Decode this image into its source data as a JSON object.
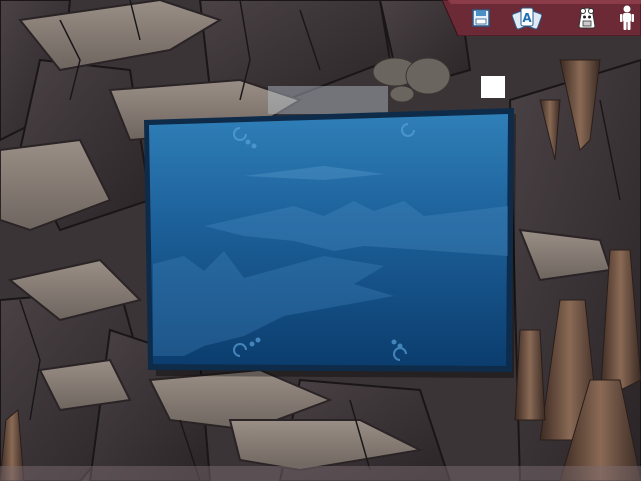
{
  "scene": {
    "type": "cave"
  },
  "toolbar": {
    "buttons": [
      {
        "id": "save",
        "icon": "save-disk-icon"
      },
      {
        "id": "cards",
        "icon": "cards-icon",
        "glyph": "A"
      },
      {
        "id": "inventory",
        "icon": "backpack-icon"
      },
      {
        "id": "character",
        "icon": "character-icon"
      }
    ]
  },
  "dialog": {
    "text": ""
  },
  "colors": {
    "panel_top": "#2f7fb8",
    "panel_bottom": "#0b3d6e",
    "panel_border": "#0e2c4a",
    "toolbar_fill": "#6b2a36",
    "rock_light": "#8a8078",
    "rock_dark": "#2e2a2c"
  }
}
